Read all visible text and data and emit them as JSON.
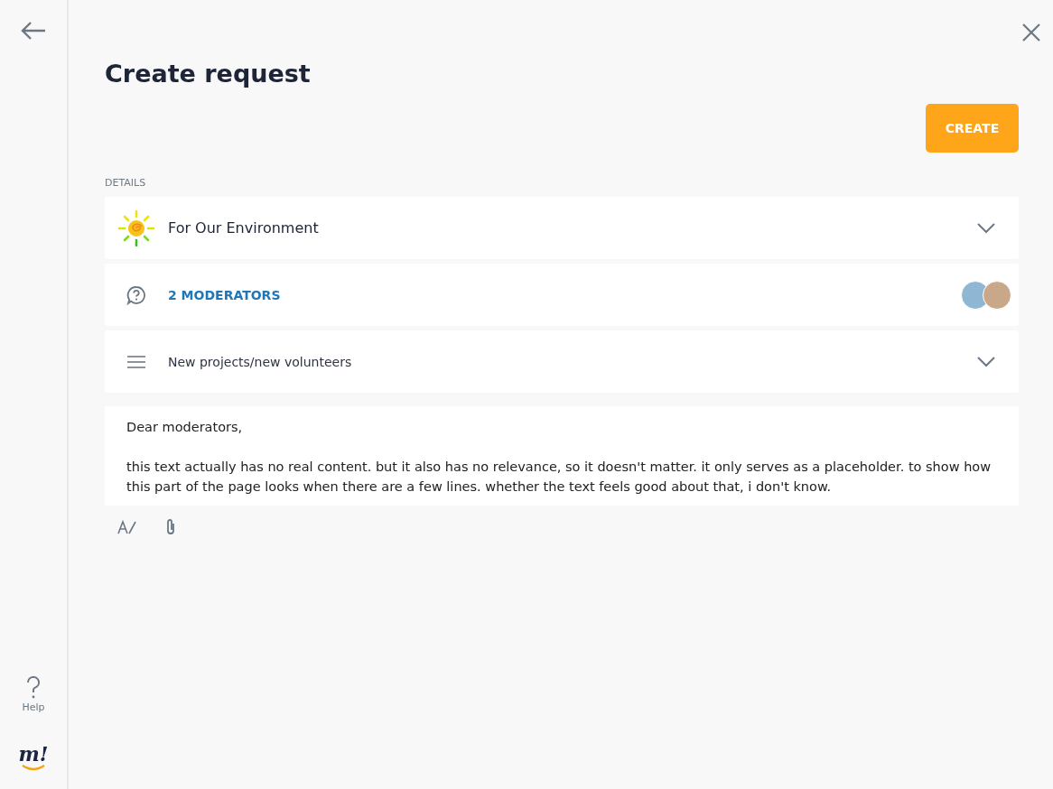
{
  "sidebar": {
    "help_label": "Help",
    "logo_text": "m!"
  },
  "page": {
    "title": "Create request",
    "create_button": "CREATE",
    "section_label": "DETAILS"
  },
  "topic": {
    "label": "For Our Environment",
    "expanded": false
  },
  "moderators": {
    "label": "2 MODERATORS"
  },
  "category": {
    "label": "New projects/new volunteers",
    "expanded": false
  },
  "message": {
    "value": [
      "Dear moderators,",
      "this text actually has no real content. but it also has no relevance, so it doesn't matter. it only serves as a placeholder. to show how this part of the page looks when there are a few lines. whether the text feels good about that, i don't know."
    ]
  }
}
